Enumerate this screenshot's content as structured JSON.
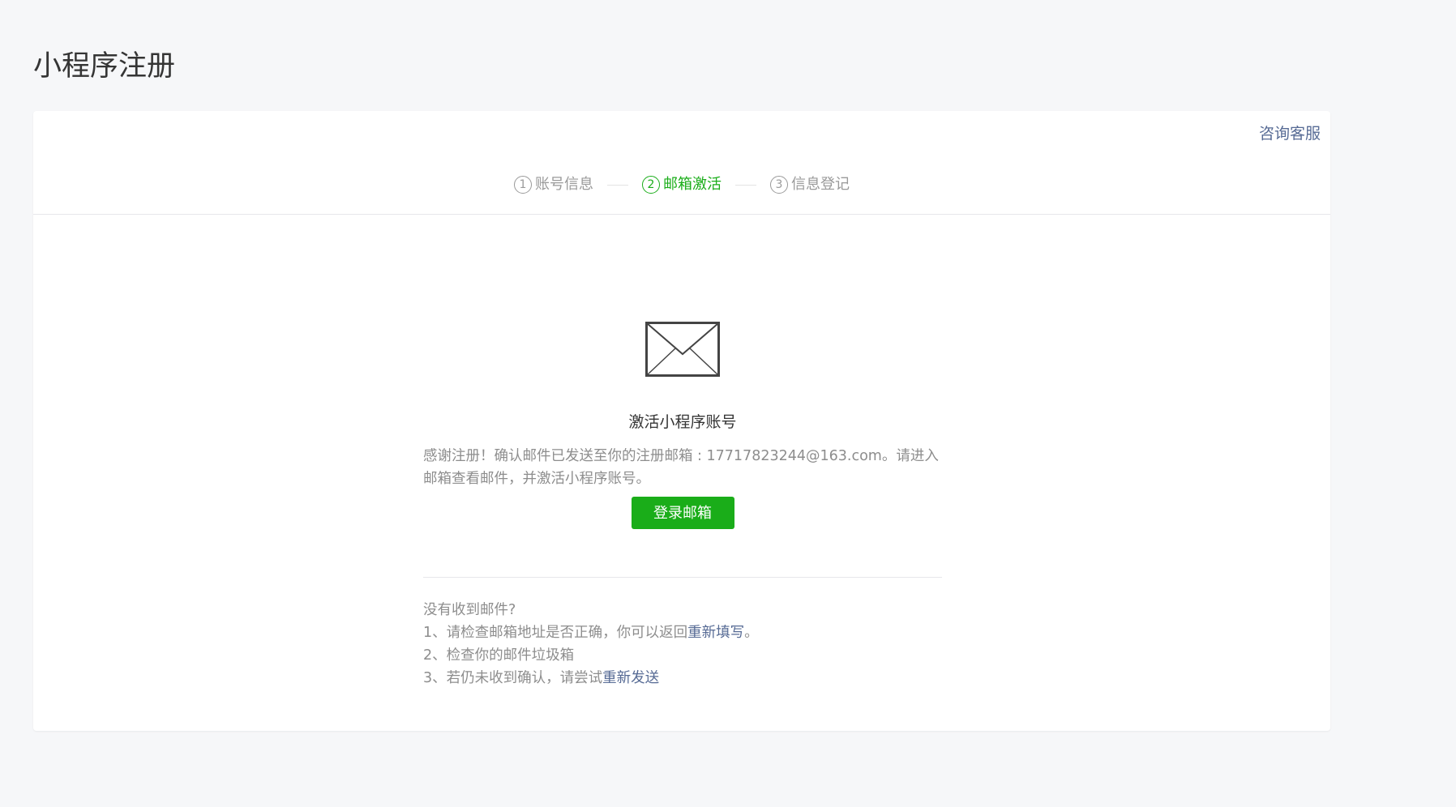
{
  "page": {
    "title": "小程序注册"
  },
  "header": {
    "consult_label": "咨询客服"
  },
  "steps": [
    {
      "num": "1",
      "label": "账号信息",
      "active": false
    },
    {
      "num": "2",
      "label": "邮箱激活",
      "active": true
    },
    {
      "num": "3",
      "label": "信息登记",
      "active": false
    }
  ],
  "activation": {
    "icon": "mail-envelope-icon",
    "title": "激活小程序账号",
    "description": "感谢注册！确认邮件已发送至你的注册邮箱 : 17717823244@163.com。请进入邮箱查看邮件，并激活小程序账号。",
    "login_button": "登录邮箱"
  },
  "help": {
    "heading": "没有收到邮件?",
    "line1_prefix": "1、请检查邮箱地址是否正确，你可以返回",
    "line1_link": "重新填写",
    "line1_suffix": "。",
    "line2": "2、检查你的邮件垃圾箱",
    "line3_prefix": "3、若仍未收到确认，请尝试",
    "line3_link": "重新发送"
  },
  "colors": {
    "accent": "#1aad19",
    "link": "#576b95",
    "background": "#f6f7f9"
  }
}
